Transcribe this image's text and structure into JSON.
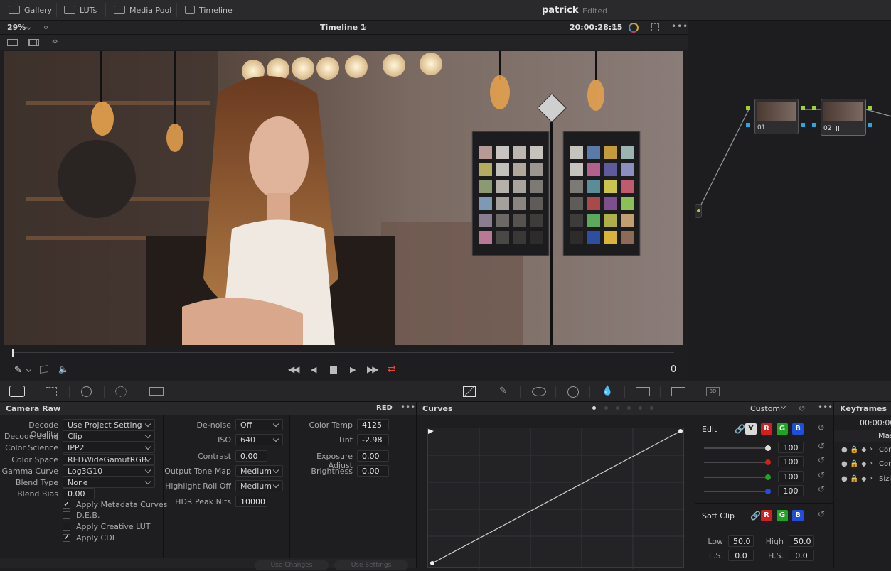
{
  "topnav": {
    "gallery": "Gallery",
    "luts": "LUTs",
    "media_pool": "Media Pool",
    "timeline": "Timeline",
    "project": "patrick",
    "status": "Edited"
  },
  "viewer": {
    "zoom": "29%",
    "timeline_name": "Timeline 1",
    "timecode": "20:00:28:15",
    "frame_counter": "0"
  },
  "nodes": [
    {
      "label": "01"
    },
    {
      "label": "02"
    }
  ],
  "camera_raw": {
    "title": "Camera Raw",
    "format": "RED",
    "decode_quality": {
      "label": "Decode Quality",
      "value": "Use Project Setting"
    },
    "decode_using": {
      "label": "Decode Using",
      "value": "Clip"
    },
    "color_science": {
      "label": "Color Science",
      "value": "IPP2"
    },
    "color_space": {
      "label": "Color Space",
      "value": "REDWideGamutRGB"
    },
    "gamma_curve": {
      "label": "Gamma Curve",
      "value": "Log3G10"
    },
    "blend_type": {
      "label": "Blend Type",
      "value": "None"
    },
    "blend_bias": {
      "label": "Blend Bias",
      "value": "0.00"
    },
    "apply_metadata_curves": {
      "label": "Apply Metadata Curves",
      "checked": true
    },
    "deb": {
      "label": "D.E.B.",
      "checked": false
    },
    "apply_creative_lut": {
      "label": "Apply Creative LUT",
      "checked": false
    },
    "apply_cdl": {
      "label": "Apply CDL",
      "checked": true
    },
    "denoise": {
      "label": "De-noise",
      "value": "Off"
    },
    "iso": {
      "label": "ISO",
      "value": "640"
    },
    "contrast": {
      "label": "Contrast",
      "value": "0.00"
    },
    "output_tone_map": {
      "label": "Output Tone Map",
      "value": "Medium"
    },
    "highlight_rolloff": {
      "label": "Highlight Roll Off",
      "value": "Medium"
    },
    "hdr_peak_nits": {
      "label": "HDR Peak Nits",
      "value": "10000"
    },
    "color_temp": {
      "label": "Color Temp",
      "value": "4125"
    },
    "tint": {
      "label": "Tint",
      "value": "-2.98"
    },
    "exposure_adjust": {
      "label": "Exposure Adjust",
      "value": "0.00"
    },
    "brightness": {
      "label": "Brightness",
      "value": "0.00"
    },
    "use_changes": "Use Changes",
    "use_settings": "Use Settings"
  },
  "curves": {
    "title": "Curves",
    "mode": "Custom",
    "edit_label": "Edit",
    "channels": [
      "Y",
      "R",
      "G",
      "B"
    ],
    "intensity": [
      "100",
      "100",
      "100",
      "100"
    ],
    "soft_clip": "Soft Clip",
    "low_label": "Low",
    "low_value": "50.0",
    "high_label": "High",
    "high_value": "50.0",
    "ls_label": "L.S.",
    "ls_value": "0.0",
    "hs_label": "H.S.",
    "hs_value": "0.0",
    "colors": {
      "y": "#d9d9d9",
      "r": "#d21f1f",
      "g": "#1fa51f",
      "b": "#1f4fd9"
    }
  },
  "keyframes": {
    "title": "Keyframes",
    "timecode": "00:00:00",
    "master": "Mas",
    "rows": [
      "Cor",
      "Cor",
      "Sizi"
    ]
  }
}
